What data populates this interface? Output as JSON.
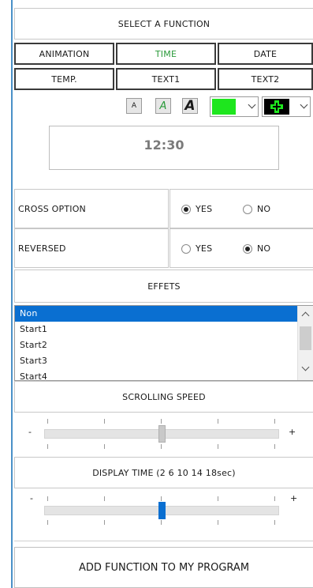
{
  "header": {
    "title": "SELECT A FUNCTION"
  },
  "functions": [
    {
      "label": "ANIMATION",
      "active": false
    },
    {
      "label": "TIME",
      "active": true
    },
    {
      "label": "DATE",
      "active": false
    },
    {
      "label": "TEMP.",
      "active": false
    },
    {
      "label": "TEXT1",
      "active": false
    },
    {
      "label": "TEXT2",
      "active": false
    }
  ],
  "format": {
    "small_a": "A",
    "italic_a": "A",
    "bold_a": "A",
    "fill_color": "#1ee61e",
    "cross_color": "#1ee61e"
  },
  "preview": {
    "text": "12:30"
  },
  "cross_option": {
    "label": "CROSS OPTION",
    "yes": "YES",
    "no": "NO",
    "selected": "yes"
  },
  "reversed": {
    "label": "REVERSED",
    "yes": "YES",
    "no": "NO",
    "selected": "no"
  },
  "effects": {
    "title": "EFFETS",
    "items": [
      "Non",
      "Start1",
      "Start2",
      "Start3",
      "Start4"
    ],
    "selected_index": 0
  },
  "scroll_speed": {
    "title": "SCROLLING SPEED",
    "minus": "-",
    "plus": "+",
    "value": 0.5
  },
  "display_time": {
    "title": "DISPLAY TIME (2 6 10 14 18sec)",
    "minus": "-",
    "plus": "+",
    "value": 0.5
  },
  "add_button": {
    "label": "ADD FUNCTION TO MY PROGRAM"
  }
}
